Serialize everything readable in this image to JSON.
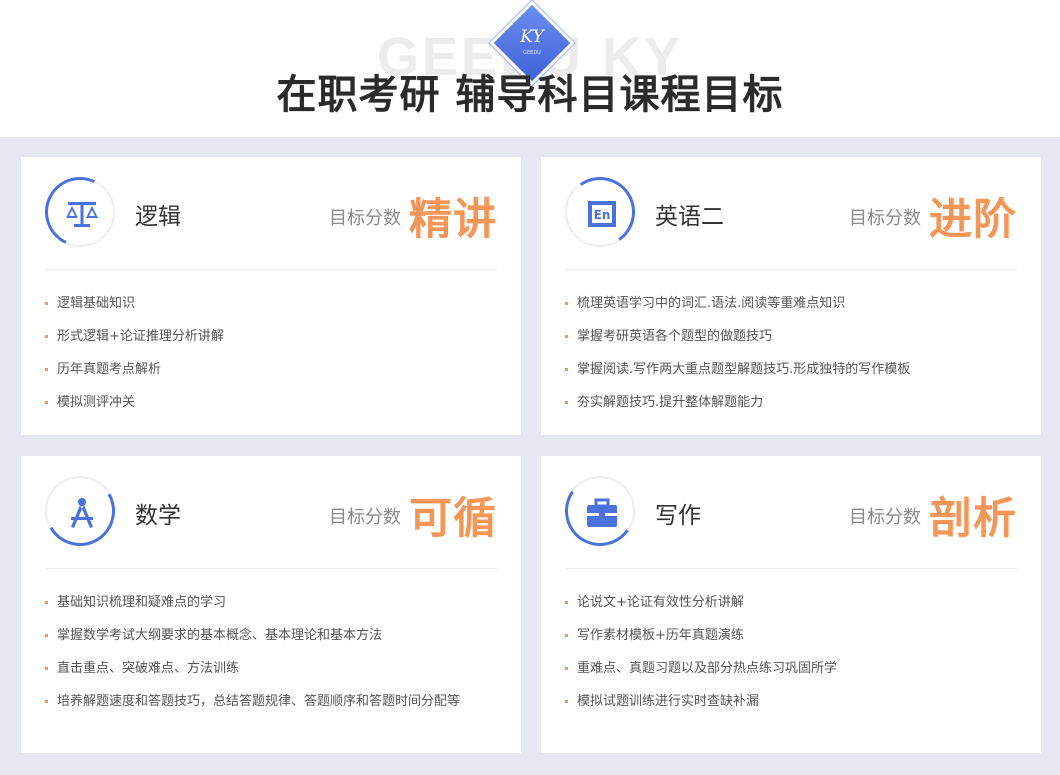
{
  "header": {
    "watermark": "GEEDU KY",
    "logo_text": "KY",
    "logo_sub": "GEEDU",
    "title": "在职考研 辅导科目课程目标"
  },
  "colors": {
    "accent_blue": "#4a72df",
    "accent_orange": "#f59556",
    "panel_bg": "#e5e8f3"
  },
  "cards": [
    {
      "icon": "scale-icon",
      "subject": "逻辑",
      "target_label": "目标分数",
      "target_word": "精讲",
      "items": [
        "逻辑基础知识",
        "形式逻辑+论证推理分析讲解",
        "历年真题考点解析",
        "模拟测评冲关"
      ]
    },
    {
      "icon": "english-book-icon",
      "subject": "英语二",
      "target_label": "目标分数",
      "target_word": "进阶",
      "items": [
        "梳理英语学习中的词汇.语法.阅读等重难点知识",
        "掌握考研英语各个题型的做题技巧",
        "掌握阅读.写作两大重点题型解题技巧.形成独特的写作模板",
        "夯实解题技巧.提升整体解题能力"
      ]
    },
    {
      "icon": "compass-icon",
      "subject": "数学",
      "target_label": "目标分数",
      "target_word": "可循",
      "items": [
        "基础知识梳理和疑难点的学习",
        "掌握数学考试大纲要求的基本概念、基本理论和基本方法",
        "直击重点、突破难点、方法训练",
        "培养解题速度和答题技巧，总结答题规律、答题顺序和答题时间分配等"
      ]
    },
    {
      "icon": "briefcase-icon",
      "subject": "写作",
      "target_label": "目标分数",
      "target_word": "剖析",
      "items": [
        "论说文+论证有效性分析讲解",
        "写作素材模板+历年真题演练",
        "重难点、真题习题以及部分热点练习巩固所学",
        "模拟试题训练进行实时查缺补漏"
      ]
    }
  ]
}
